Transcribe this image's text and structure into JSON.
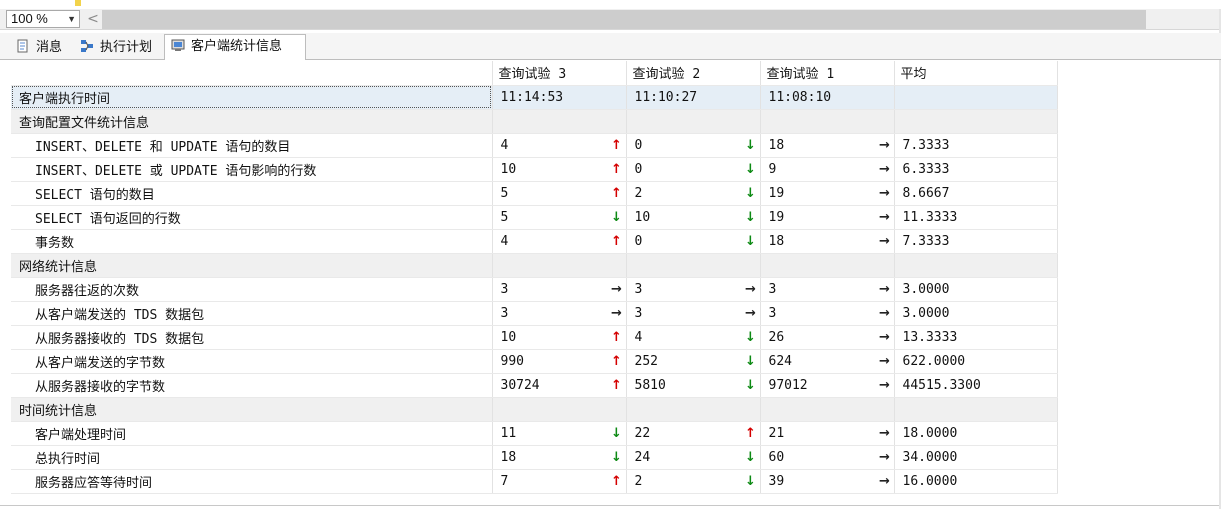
{
  "toolbar": {
    "zoom": "100 %"
  },
  "tabs": [
    {
      "label": "消息",
      "icon": "messages-icon"
    },
    {
      "label": "执行计划",
      "icon": "execution-plan-icon"
    },
    {
      "label": "客户端统计信息",
      "icon": "client-statistics-icon"
    }
  ],
  "columns": [
    "查询试验 3",
    "查询试验 2",
    "查询试验 1",
    "平均"
  ],
  "colors": {
    "up": "#d40000",
    "down": "#0d8a14",
    "neutral": "#222222"
  },
  "groups": [
    {
      "label": "客户端执行时间",
      "values": [
        "11:14:53",
        "11:10:27",
        "11:08:10",
        ""
      ],
      "rows": []
    },
    {
      "label": "查询配置文件统计信息",
      "values": [],
      "rows": [
        {
          "label": "INSERT、DELETE 和 UPDATE 语句的数目",
          "cells": [
            {
              "v": "4",
              "t": "up"
            },
            {
              "v": "0",
              "t": "down"
            },
            {
              "v": "18",
              "t": "right"
            },
            {
              "v": "7.3333"
            }
          ]
        },
        {
          "label": "INSERT、DELETE 或 UPDATE 语句影响的行数",
          "cells": [
            {
              "v": "10",
              "t": "up"
            },
            {
              "v": "0",
              "t": "down"
            },
            {
              "v": "9",
              "t": "right"
            },
            {
              "v": "6.3333"
            }
          ]
        },
        {
          "label": "SELECT 语句的数目",
          "cells": [
            {
              "v": "5",
              "t": "up"
            },
            {
              "v": "2",
              "t": "down"
            },
            {
              "v": "19",
              "t": "right"
            },
            {
              "v": "8.6667"
            }
          ]
        },
        {
          "label": "SELECT 语句返回的行数",
          "cells": [
            {
              "v": "5",
              "t": "down"
            },
            {
              "v": "10",
              "t": "down"
            },
            {
              "v": "19",
              "t": "right"
            },
            {
              "v": "11.3333"
            }
          ]
        },
        {
          "label": "事务数",
          "cells": [
            {
              "v": "4",
              "t": "up"
            },
            {
              "v": "0",
              "t": "down"
            },
            {
              "v": "18",
              "t": "right"
            },
            {
              "v": "7.3333"
            }
          ]
        }
      ]
    },
    {
      "label": "网络统计信息",
      "values": [],
      "rows": [
        {
          "label": "服务器往返的次数",
          "cells": [
            {
              "v": "3",
              "t": "right"
            },
            {
              "v": "3",
              "t": "right"
            },
            {
              "v": "3",
              "t": "right"
            },
            {
              "v": "3.0000"
            }
          ]
        },
        {
          "label": "从客户端发送的 TDS 数据包",
          "cells": [
            {
              "v": "3",
              "t": "right"
            },
            {
              "v": "3",
              "t": "right"
            },
            {
              "v": "3",
              "t": "right"
            },
            {
              "v": "3.0000"
            }
          ]
        },
        {
          "label": "从服务器接收的 TDS 数据包",
          "cells": [
            {
              "v": "10",
              "t": "up"
            },
            {
              "v": "4",
              "t": "down"
            },
            {
              "v": "26",
              "t": "right"
            },
            {
              "v": "13.3333"
            }
          ]
        },
        {
          "label": "从客户端发送的字节数",
          "cells": [
            {
              "v": "990",
              "t": "up"
            },
            {
              "v": "252",
              "t": "down"
            },
            {
              "v": "624",
              "t": "right"
            },
            {
              "v": "622.0000"
            }
          ]
        },
        {
          "label": "从服务器接收的字节数",
          "cells": [
            {
              "v": "30724",
              "t": "up"
            },
            {
              "v": "5810",
              "t": "down"
            },
            {
              "v": "97012",
              "t": "right"
            },
            {
              "v": "44515.3300"
            }
          ]
        }
      ]
    },
    {
      "label": "时间统计信息",
      "values": [],
      "rows": [
        {
          "label": "客户端处理时间",
          "cells": [
            {
              "v": "11",
              "t": "down"
            },
            {
              "v": "22",
              "t": "up"
            },
            {
              "v": "21",
              "t": "right"
            },
            {
              "v": "18.0000"
            }
          ]
        },
        {
          "label": "总执行时间",
          "cells": [
            {
              "v": "18",
              "t": "down"
            },
            {
              "v": "24",
              "t": "down"
            },
            {
              "v": "60",
              "t": "right"
            },
            {
              "v": "34.0000"
            }
          ]
        },
        {
          "label": "服务器应答等待时间",
          "cells": [
            {
              "v": "7",
              "t": "up"
            },
            {
              "v": "2",
              "t": "down"
            },
            {
              "v": "39",
              "t": "right"
            },
            {
              "v": "16.0000"
            }
          ]
        }
      ]
    }
  ]
}
